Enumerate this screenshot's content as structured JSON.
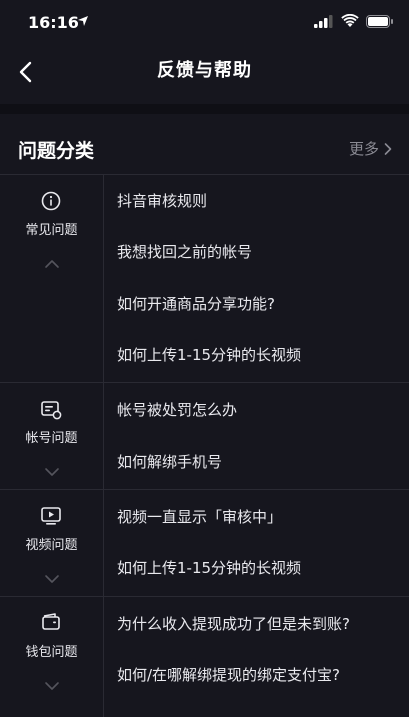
{
  "status_bar": {
    "time": "16:16"
  },
  "nav": {
    "title": "反馈与帮助"
  },
  "section": {
    "title": "问题分类",
    "more": "更多"
  },
  "categories": [
    {
      "label": "常见问题",
      "icon": "info-icon",
      "chevron": "up",
      "questions": [
        "抖音审核规则",
        "我想找回之前的帐号",
        "如何开通商品分享功能?",
        "如何上传1-15分钟的长视频"
      ]
    },
    {
      "label": "帐号问题",
      "icon": "account-card-icon",
      "chevron": "down",
      "questions": [
        "帐号被处罚怎么办",
        "如何解绑手机号"
      ]
    },
    {
      "label": "视频问题",
      "icon": "video-play-icon",
      "chevron": "down",
      "questions": [
        "视频一直显示「审核中」",
        "如何上传1-15分钟的长视频"
      ]
    },
    {
      "label": "钱包问题",
      "icon": "wallet-icon",
      "chevron": "down",
      "questions": [
        "为什么收入提现成功了但是未到账?",
        "如何/在哪解绑提现的绑定支付宝?"
      ]
    }
  ]
}
